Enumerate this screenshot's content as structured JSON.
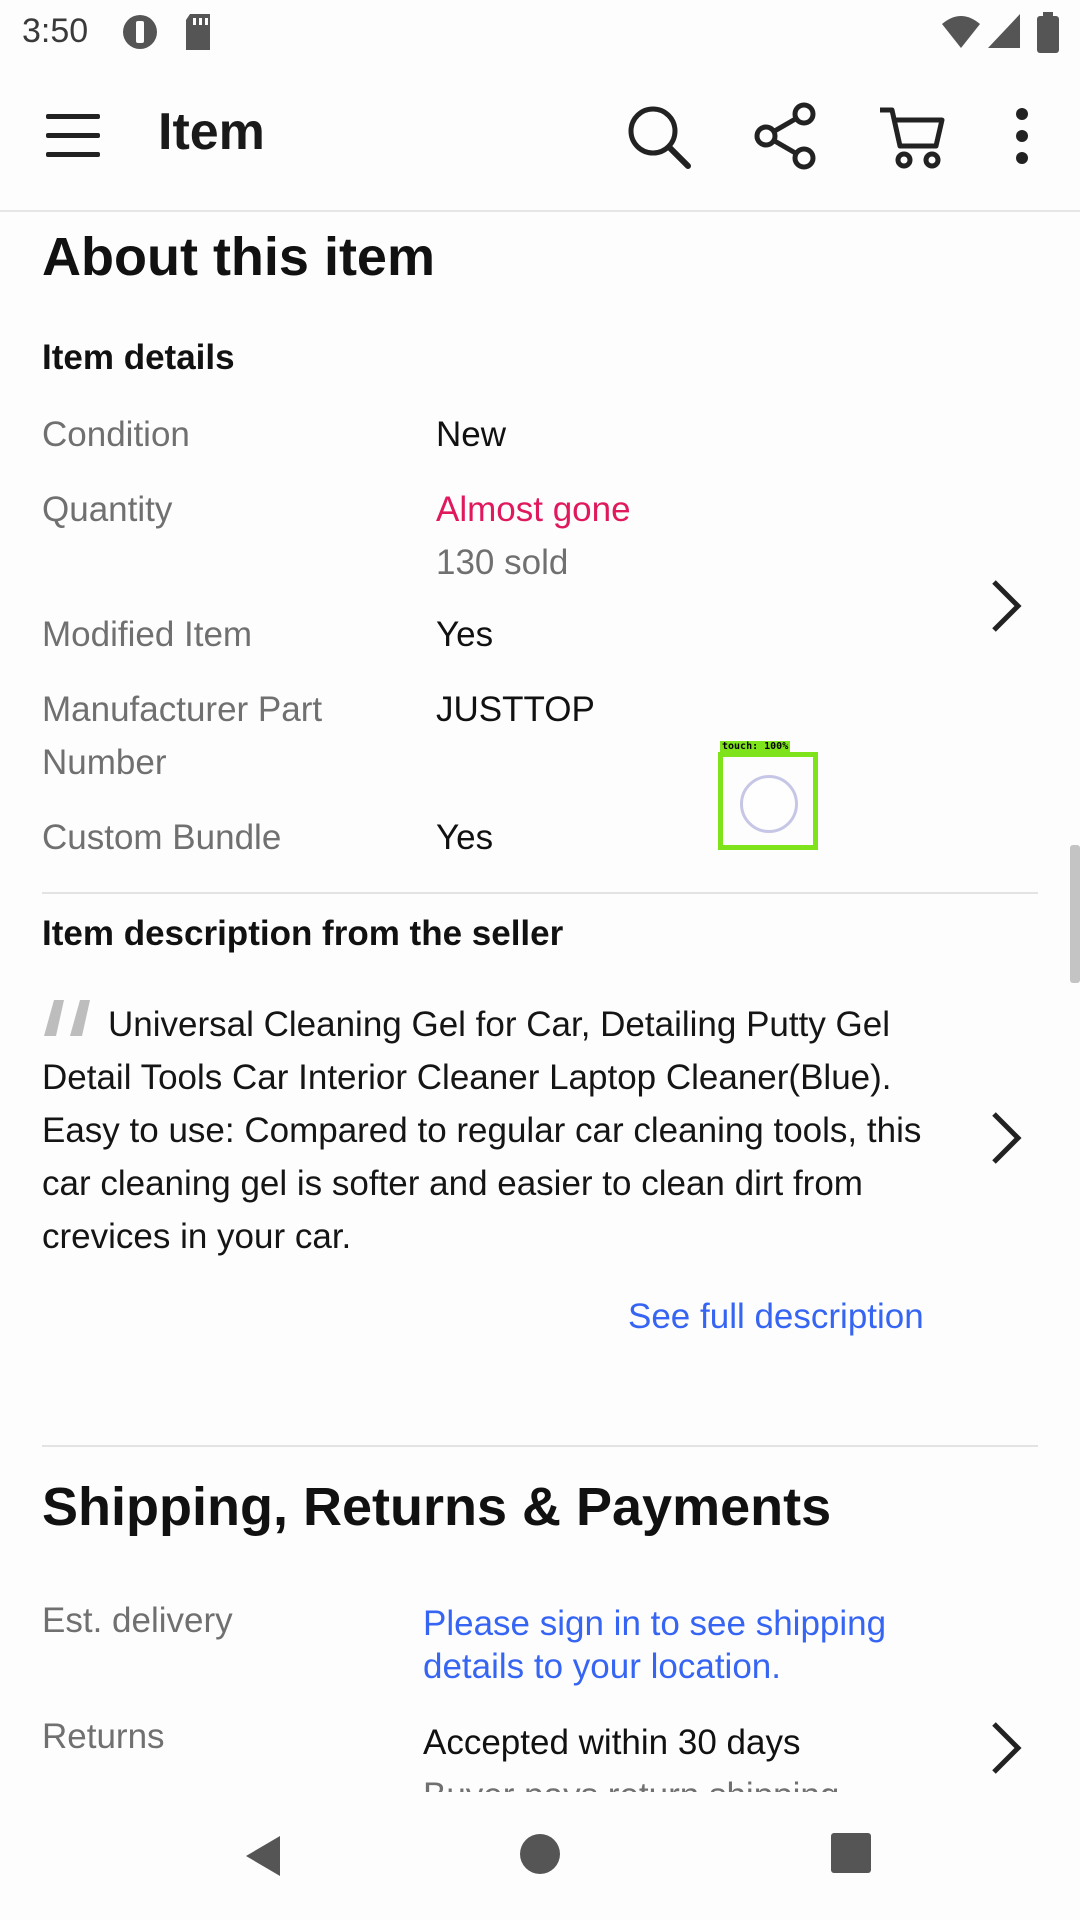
{
  "status_bar": {
    "time": "3:50"
  },
  "app_bar": {
    "title": "Item",
    "icons": [
      "menu-icon",
      "search-icon",
      "share-icon",
      "cart-icon",
      "more-vert-icon"
    ]
  },
  "about": {
    "title": "About this item",
    "details_heading": "Item details",
    "specs": [
      {
        "label": "Condition",
        "value": "New"
      },
      {
        "label": "Quantity",
        "value": "Almost gone",
        "sub_value": "130 sold"
      },
      {
        "label": "Modified Item",
        "value": "Yes"
      },
      {
        "label": "Manufacturer Part Number",
        "value": "JUSTTOP"
      },
      {
        "label": "Custom Bundle",
        "value": "Yes"
      }
    ],
    "description_heading": "Item description from the seller",
    "description": "Universal Cleaning Gel for Car, Detailing Putty Gel Detail Tools Car Interior Cleaner Laptop Cleaner(Blue). Easy to use: Compared to regular car cleaning tools, this car cleaning gel is softer and easier to clean dirt from crevices in your car.",
    "see_full_description": "See full description"
  },
  "shipping": {
    "title": "Shipping, Returns & Payments",
    "rows": [
      {
        "label": "Est. delivery",
        "value": "Please sign in to see shipping details to your location."
      },
      {
        "label": "Returns",
        "value": "Accepted within 30 days",
        "sub_value": "Buyer pays return shipping"
      }
    ]
  },
  "touch_overlay": {
    "label": "touch: 100%"
  },
  "colors": {
    "accent_red": "#e0195f",
    "link_blue": "#3665f3",
    "touch_green": "#7fe31b"
  }
}
